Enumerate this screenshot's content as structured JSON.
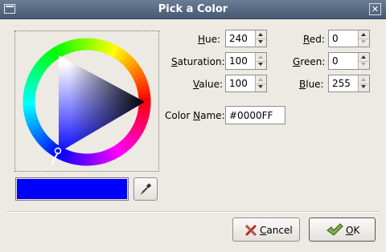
{
  "window": {
    "title": "Pick a Color",
    "close_glyph": "✕"
  },
  "wheel": {
    "hue_degrees": 240,
    "selected_color": "#0000FF"
  },
  "preview": {
    "color": "#0000FF"
  },
  "fields": {
    "hue": {
      "label_pre": "",
      "label_u": "H",
      "label_post": "ue:",
      "value": "240"
    },
    "saturation": {
      "label_pre": "",
      "label_u": "S",
      "label_post": "aturation:",
      "value": "100"
    },
    "value": {
      "label_pre": "",
      "label_u": "V",
      "label_post": "alue:",
      "value": "100"
    },
    "red": {
      "label_pre": "",
      "label_u": "R",
      "label_post": "ed:",
      "value": "0"
    },
    "green": {
      "label_pre": "",
      "label_u": "G",
      "label_post": "reen:",
      "value": "0"
    },
    "blue": {
      "label_pre": "",
      "label_u": "B",
      "label_post": "lue:",
      "value": "255"
    }
  },
  "color_name": {
    "label_pre": "Color ",
    "label_u": "N",
    "label_post": "ame:",
    "value": "#0000FF"
  },
  "buttons": {
    "cancel": {
      "label_u": "C",
      "label_rest": "ancel",
      "icon": "cancel-x-icon"
    },
    "ok": {
      "label_u": "O",
      "label_rest": "K",
      "icon": "ok-checkmark-icon"
    }
  },
  "icons": {
    "eyedropper": "eyedropper-icon",
    "window_menu": "window-menu-icon"
  }
}
